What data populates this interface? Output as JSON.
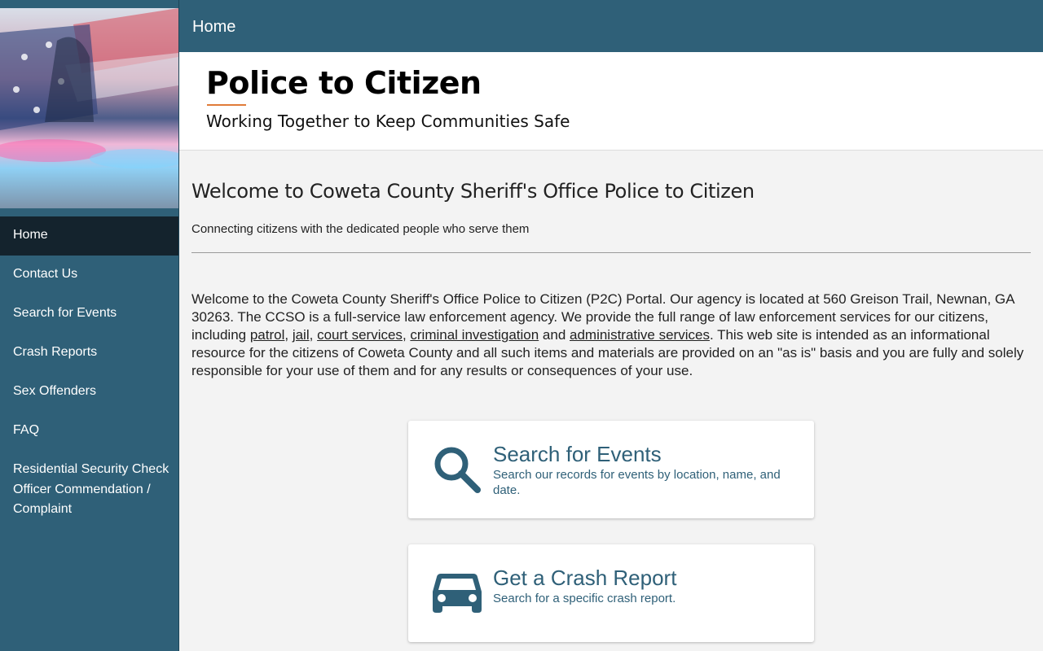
{
  "colors": {
    "primary": "#2f6078",
    "nav_active": "#14232d",
    "accent": "#e07b39",
    "background": "#f3f3f3"
  },
  "sidebar": {
    "banner_icon": "flag-police-lights-image",
    "items": [
      {
        "label": "Home",
        "active": true
      },
      {
        "label": "Contact Us"
      },
      {
        "label": "Search for Events"
      },
      {
        "label": "Crash Reports"
      },
      {
        "label": "Sex Offenders"
      },
      {
        "label": "FAQ"
      },
      {
        "label": "Residential Security Check"
      },
      {
        "label": "Officer Commendation / Complaint"
      }
    ]
  },
  "topbar": {
    "title": "Home"
  },
  "hero": {
    "title": "Police to Citizen",
    "subtitle": "Working Together to Keep Communities Safe"
  },
  "main": {
    "heading": "Welcome to Coweta County Sheriff's Office Police to Citizen",
    "tagline": "Connecting citizens with the dedicated people who serve them",
    "intro": {
      "part1": "Welcome to the Coweta County Sheriff's Office Police to Citizen (P2C) Portal. Our agency is located at 560 Greison Trail, Newnan, GA 30263. The CCSO is a full-service law enforcement agency. We provide the full range of law enforcement services for our citizens, including ",
      "link_patrol": "patrol",
      "sep1": ", ",
      "link_jail": "jail",
      "sep2": ", ",
      "link_court": "court services",
      "sep3": ", ",
      "link_criminal": "criminal investigation",
      "sep4": " and ",
      "link_admin": "administrative services",
      "part2": ". This web site is intended as an informational resource for the citizens of Coweta County and all such items and materials are provided on an \"as is\" basis and you are fully and solely responsible for your use of them and for any results or consequences of your use."
    },
    "cards": [
      {
        "icon": "search-icon",
        "title": "Search for Events",
        "description": "Search our records for events by location, name, and date."
      },
      {
        "icon": "car-icon",
        "title": "Get a Crash Report",
        "description": "Search for a specific crash report."
      }
    ]
  }
}
